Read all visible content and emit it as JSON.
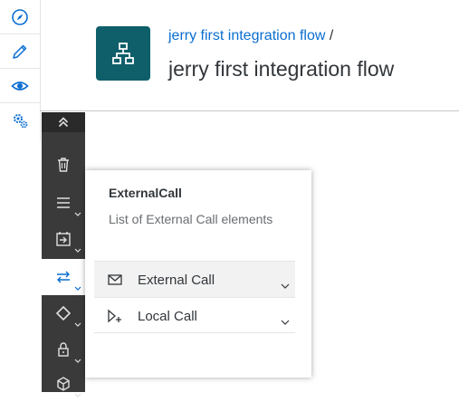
{
  "colors": {
    "accent": "#0a6ed1",
    "tile": "#0f5f6a",
    "palette": "#3a3a3a",
    "text": "#32363a"
  },
  "left_nav": {
    "items": [
      {
        "icon": "compass-icon",
        "name": "discover"
      },
      {
        "icon": "pencil-icon",
        "name": "design"
      },
      {
        "icon": "eye-icon",
        "name": "monitor"
      },
      {
        "icon": "gears-icon",
        "name": "settings"
      }
    ]
  },
  "header": {
    "breadcrumb_link": "jerry first integration flow",
    "breadcrumb_sep": " /",
    "title": "jerry first integration flow",
    "tile_icon": "integration-flow-icon"
  },
  "palette": {
    "items": [
      {
        "icon": "collapse-double-up-icon"
      },
      {
        "icon": "trash-icon"
      },
      {
        "icon": "menu-lines-icon"
      },
      {
        "icon": "process-call-icon"
      },
      {
        "icon": "exchange-arrows-icon"
      },
      {
        "icon": "diamond-icon"
      },
      {
        "icon": "lock-icon"
      },
      {
        "icon": "cube-icon"
      }
    ]
  },
  "popover": {
    "title": "ExternalCall",
    "description": "List of External Call elements",
    "items": [
      {
        "label": "External Call",
        "icon": "envelope-icon"
      },
      {
        "label": "Local Call",
        "icon": "local-call-icon"
      }
    ]
  }
}
